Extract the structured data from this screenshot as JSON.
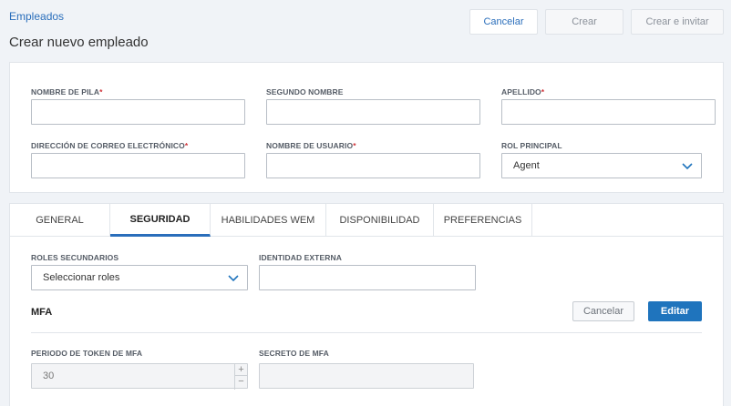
{
  "header": {
    "breadcrumb": "Empleados",
    "title": "Crear nuevo empleado",
    "cancel_label": "Cancelar",
    "create_label": "Crear",
    "create_invite_label": "Crear e invitar"
  },
  "form": {
    "first_name_label": "NOMBRE DE PILA",
    "middle_name_label": "SEGUNDO NOMBRE",
    "last_name_label": "APELLIDO",
    "email_label": "DIRECCIÓN DE CORREO ELECTRÓNICO",
    "username_label": "NOMBRE DE USUARIO",
    "primary_role_label": "ROL PRINCIPAL",
    "primary_role_value": "Agent",
    "required_marker": "*"
  },
  "tabs": [
    {
      "label": "GENERAL"
    },
    {
      "label": "SEGURIDAD"
    },
    {
      "label": "HABILIDADES WEM"
    },
    {
      "label": "DISPONIBILIDAD"
    },
    {
      "label": "PREFERENCIAS"
    }
  ],
  "active_tab": "SEGURIDAD",
  "security": {
    "secondary_roles_label": "ROLES SECUNDARIOS",
    "secondary_roles_placeholder": "Seleccionar roles",
    "external_identity_label": "IDENTIDAD EXTERNA",
    "mfa_title": "MFA",
    "mfa_cancel_label": "Cancelar",
    "mfa_edit_label": "Editar",
    "mfa_token_period_label": "PERIODO DE TOKEN DE MFA",
    "mfa_token_period_value": "30",
    "mfa_secret_label": "SECRETO DE MFA",
    "stepper_plus": "+",
    "stepper_minus": "−"
  },
  "colors": {
    "accent": "#2a6ebb",
    "primary_button": "#1f74bd",
    "required": "#d0343a",
    "background": "#f0f3f7"
  }
}
